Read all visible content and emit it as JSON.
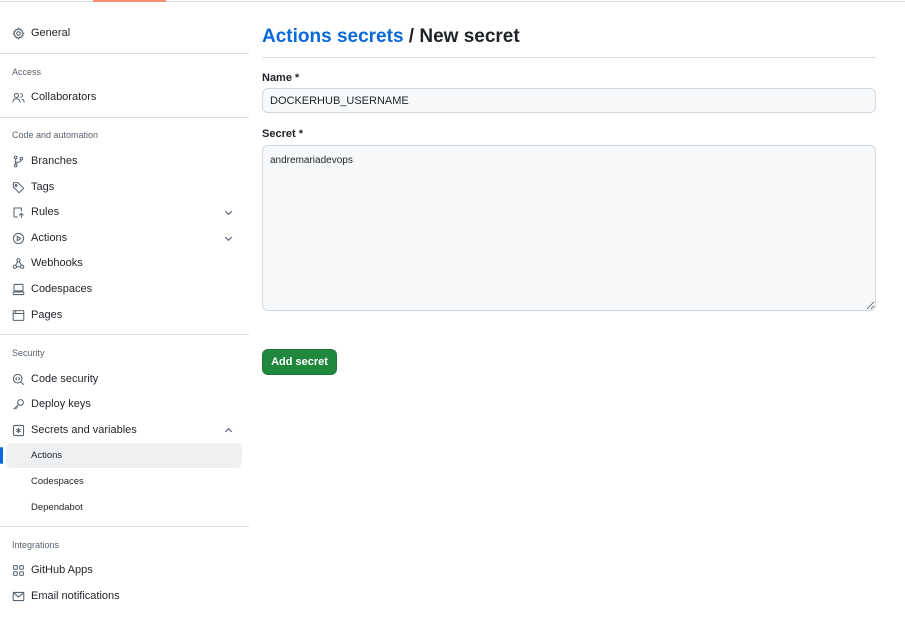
{
  "sidebar": {
    "general": {
      "label": "General",
      "icon": "gear-icon"
    },
    "sections": {
      "access": "Access",
      "code_automation": "Code and automation",
      "security": "Security",
      "integrations": "Integrations"
    },
    "collaborators": {
      "label": "Collaborators",
      "icon": "people-icon"
    },
    "branches": {
      "label": "Branches",
      "icon": "branch-icon"
    },
    "tags": {
      "label": "Tags",
      "icon": "tag-icon"
    },
    "rules": {
      "label": "Rules",
      "icon": "rules-icon"
    },
    "actions": {
      "label": "Actions",
      "icon": "play-icon"
    },
    "webhooks": {
      "label": "Webhooks",
      "icon": "webhook-icon"
    },
    "codespaces": {
      "label": "Codespaces",
      "icon": "codespaces-icon"
    },
    "pages": {
      "label": "Pages",
      "icon": "browser-icon"
    },
    "code_security": {
      "label": "Code security",
      "icon": "codescan-icon"
    },
    "deploy_keys": {
      "label": "Deploy keys",
      "icon": "key-icon"
    },
    "secrets_variables": {
      "label": "Secrets and variables",
      "icon": "asterisk-icon",
      "items": [
        "Actions",
        "Codespaces",
        "Dependabot"
      ],
      "active": "Actions"
    },
    "github_apps": {
      "label": "GitHub Apps",
      "icon": "apps-icon"
    },
    "email_notifications": {
      "label": "Email notifications",
      "icon": "mail-icon"
    }
  },
  "main": {
    "breadcrumb_link": "Actions secrets",
    "separator": "/",
    "title": "New secret",
    "name_label": "Name *",
    "name_value": "DOCKERHUB_USERNAME",
    "secret_label": "Secret *",
    "secret_value": "andremariadevops",
    "submit_label": "Add secret"
  },
  "colors": {
    "link": "#0969da",
    "primary_button": "#1f883d",
    "active_indicator": "#0969da",
    "tab_underline": "#fd8c73"
  }
}
